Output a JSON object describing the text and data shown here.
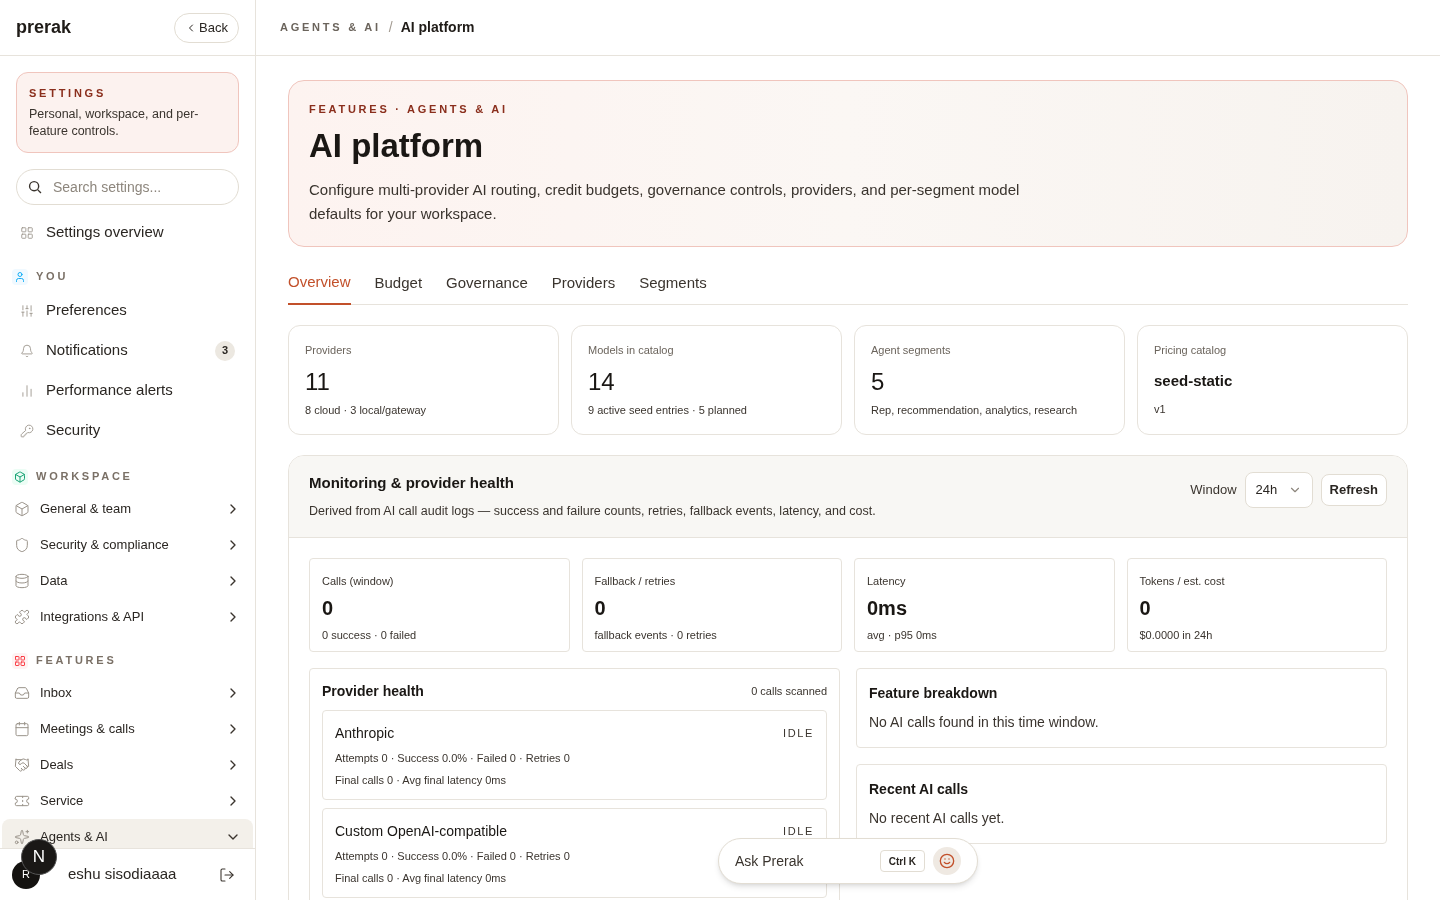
{
  "sidebar": {
    "brand": "prerak",
    "back_button": "Back",
    "settings_card": {
      "title": "SETTINGS",
      "text": "Personal, workspace, and per-feature controls."
    },
    "search": {
      "placeholder": "Search settings..."
    },
    "overview_item": {
      "label": "Settings overview",
      "selected": false
    },
    "sections": [
      {
        "title": "YOU",
        "items": [
          {
            "label": "Preferences",
            "selected": false
          },
          {
            "label": "Notifications",
            "count": "3",
            "selected": false
          },
          {
            "label": "Performance alerts",
            "selected": false
          },
          {
            "label": "Security",
            "selected": false
          }
        ]
      },
      {
        "title": "WORKSPACE",
        "items": [
          {
            "label": "General & team",
            "selected": false,
            "expanded": false
          },
          {
            "label": "Security & compliance",
            "selected": false,
            "expanded": false
          },
          {
            "label": "Data",
            "selected": false,
            "expanded": false
          },
          {
            "label": "Integrations & API",
            "selected": false,
            "expanded": false
          }
        ]
      },
      {
        "title": "FEATURES",
        "items": [
          {
            "label": "Inbox",
            "selected": false,
            "expanded": false
          },
          {
            "label": "Meetings & calls",
            "selected": false,
            "expanded": false
          },
          {
            "label": "Deals",
            "selected": false,
            "expanded": false
          },
          {
            "label": "Service",
            "selected": false,
            "expanded": false
          },
          {
            "label": "Agents & AI",
            "selected": true,
            "expanded": true
          }
        ]
      }
    ],
    "user": {
      "avatar": "R",
      "name": "eshu sisodiaaaa"
    },
    "dev_badge": "N"
  },
  "breadcrumb": [
    "AGENTS & AI",
    "/",
    "AI platform"
  ],
  "hero": {
    "eyebrow": "FEATURES · AGENTS & AI",
    "title": "AI platform",
    "description": "Configure multi-provider AI routing, credit budgets, governance controls, providers, and per-segment model defaults for your workspace."
  },
  "tabs": [
    {
      "label": "Overview",
      "selected": true
    },
    {
      "label": "Budget",
      "selected": false
    },
    {
      "label": "Governance",
      "selected": false
    },
    {
      "label": "Providers",
      "selected": false
    },
    {
      "label": "Segments",
      "selected": false
    }
  ],
  "stat_cards": [
    {
      "kind": "number",
      "label": "Providers",
      "value": "11",
      "note": "8 cloud · 3 local/gateway"
    },
    {
      "kind": "number",
      "label": "Models in catalog",
      "value": "14",
      "note": "9 active seed entries · 5 planned"
    },
    {
      "kind": "number",
      "label": "Agent segments",
      "value": "5",
      "note": "Rep, recommendation, analytics, research"
    },
    {
      "kind": "name",
      "label": "Pricing catalog",
      "value": "seed-static",
      "note": "v1"
    }
  ],
  "monitoring": {
    "title": "Monitoring & provider health",
    "description": "Derived from AI call audit logs — success and failure counts, retries, fallback events, latency, and cost.",
    "window_label": "Window",
    "window_value": "24h",
    "refresh_button": "Refresh",
    "metrics": [
      {
        "label": "Calls (window)",
        "value": "0",
        "note": "0 success · 0 failed"
      },
      {
        "label": "Fallback / retries",
        "value": "0",
        "note": "fallback events · 0 retries"
      },
      {
        "label": "Latency",
        "value": "0ms",
        "note": "avg · p95 0ms"
      },
      {
        "label": "Tokens / est. cost",
        "value": "0",
        "note": "$0.0000 in 24h"
      }
    ],
    "provider_health": {
      "title": "Provider health",
      "count": "0 calls scanned",
      "providers": [
        {
          "name": "Anthropic",
          "status": "IDLE",
          "line1": "Attempts 0 · Success 0.0% · Failed 0 · Retries 0",
          "line2": "Final calls 0 · Avg final latency 0ms"
        },
        {
          "name": "Custom OpenAI-compatible",
          "status": "IDLE",
          "line1": "Attempts 0 · Success 0.0% · Failed 0 · Retries 0",
          "line2": "Final calls 0 · Avg final latency 0ms"
        }
      ]
    },
    "panels": [
      {
        "title": "Feature breakdown",
        "text": "No AI calls found in this time window."
      },
      {
        "title": "Recent AI calls",
        "text": "No recent AI calls yet."
      }
    ]
  },
  "ask_bar": {
    "label": "Ask Prerak",
    "shortcut": "Ctrl K"
  }
}
